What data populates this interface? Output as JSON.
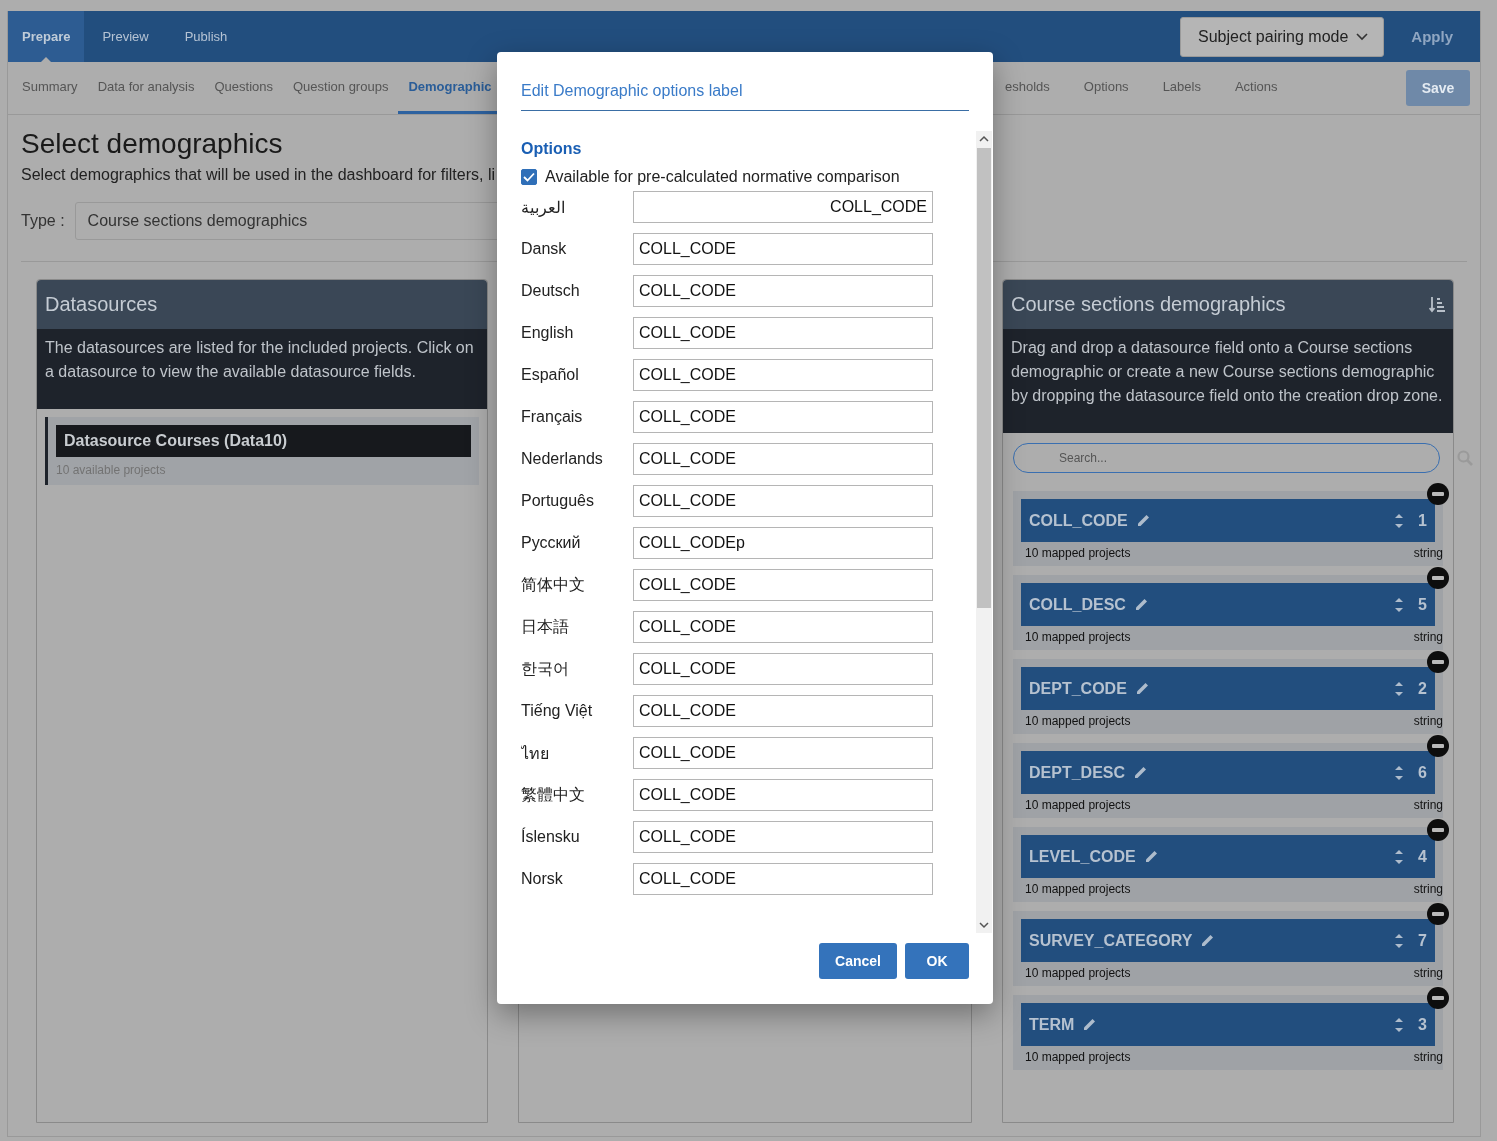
{
  "top_tabs": [
    {
      "label": "Prepare",
      "selected": true
    },
    {
      "label": "Preview",
      "selected": false
    },
    {
      "label": "Publish",
      "selected": false
    }
  ],
  "mode_dropdown": {
    "label": "Subject pairing mode"
  },
  "apply_button": {
    "label": "Apply"
  },
  "sub_tabs_left": [
    {
      "label": "Summary",
      "selected": false
    },
    {
      "label": "Data for analysis",
      "selected": false
    },
    {
      "label": "Questions",
      "selected": false
    },
    {
      "label": "Question groups",
      "selected": false
    },
    {
      "label": "Demographic",
      "selected": true
    }
  ],
  "sub_tabs_right": [
    {
      "label": "esholds",
      "selected": false
    },
    {
      "label": "Options",
      "selected": false
    },
    {
      "label": "Labels",
      "selected": false
    },
    {
      "label": "Actions",
      "selected": false
    }
  ],
  "save_button": {
    "label": "Save",
    "disabled": true
  },
  "page": {
    "title": "Select demographics",
    "description": "Select demographics that will be used in the dashboard for filters, li",
    "type_label": "Type :",
    "type_value": "Course sections demographics"
  },
  "datasources": {
    "title": "Datasources",
    "description": "The datasources are listed for the included projects. Click on a datasource to view the available datasource fields.",
    "items": [
      {
        "name": "Datasource Courses (Data10)",
        "projects": "10 available projects"
      }
    ]
  },
  "demographics": {
    "title": "Course sections demographics",
    "description": "Drag and drop a datasource field onto a Course sections demographic or create a new Course sections demographic by dropping the datasource field onto the creation drop zone.",
    "search": {
      "placeholder": "Search..."
    },
    "items": [
      {
        "name": "COLL_CODE",
        "order": "1",
        "mapped": "10 mapped projects",
        "type": "string"
      },
      {
        "name": "COLL_DESC",
        "order": "5",
        "mapped": "10 mapped projects",
        "type": "string"
      },
      {
        "name": "DEPT_CODE",
        "order": "2",
        "mapped": "10 mapped projects",
        "type": "string"
      },
      {
        "name": "DEPT_DESC",
        "order": "6",
        "mapped": "10 mapped projects",
        "type": "string"
      },
      {
        "name": "LEVEL_CODE",
        "order": "4",
        "mapped": "10 mapped projects",
        "type": "string"
      },
      {
        "name": "SURVEY_CATEGORY",
        "order": "7",
        "mapped": "10 mapped projects",
        "type": "string"
      },
      {
        "name": "TERM",
        "order": "3",
        "mapped": "10 mapped projects",
        "type": "string"
      }
    ]
  },
  "dialog": {
    "title": "Edit Demographic options label",
    "options_heading": "Options",
    "normative": {
      "label": "Available for pre-calculated normative comparison",
      "checked": true
    },
    "labels": [
      {
        "language": "العربية",
        "value": "COLL_CODE",
        "rtl": true
      },
      {
        "language": "Dansk",
        "value": "COLL_CODE",
        "rtl": false
      },
      {
        "language": "Deutsch",
        "value": "COLL_CODE",
        "rtl": false
      },
      {
        "language": "English",
        "value": "COLL_CODE",
        "rtl": false
      },
      {
        "language": "Español",
        "value": "COLL_CODE",
        "rtl": false
      },
      {
        "language": "Français",
        "value": "COLL_CODE",
        "rtl": false
      },
      {
        "language": "Nederlands",
        "value": "COLL_CODE",
        "rtl": false
      },
      {
        "language": "Português",
        "value": "COLL_CODE",
        "rtl": false
      },
      {
        "language": "Русский",
        "value": "COLL_CODEp",
        "rtl": false
      },
      {
        "language": "简体中文",
        "value": "COLL_CODE",
        "rtl": false
      },
      {
        "language": "日本語",
        "value": "COLL_CODE",
        "rtl": false
      },
      {
        "language": "한국어",
        "value": "COLL_CODE",
        "rtl": false
      },
      {
        "language": "Tiếng Việt",
        "value": "COLL_CODE",
        "rtl": false
      },
      {
        "language": "ไทย",
        "value": "COLL_CODE",
        "rtl": false
      },
      {
        "language": "繁體中文",
        "value": "COLL_CODE",
        "rtl": false
      },
      {
        "language": "Íslensku",
        "value": "COLL_CODE",
        "rtl": false
      },
      {
        "language": "Norsk",
        "value": "COLL_CODE",
        "rtl": false
      }
    ],
    "buttons": [
      {
        "label": "Cancel"
      },
      {
        "label": "OK"
      }
    ]
  }
}
